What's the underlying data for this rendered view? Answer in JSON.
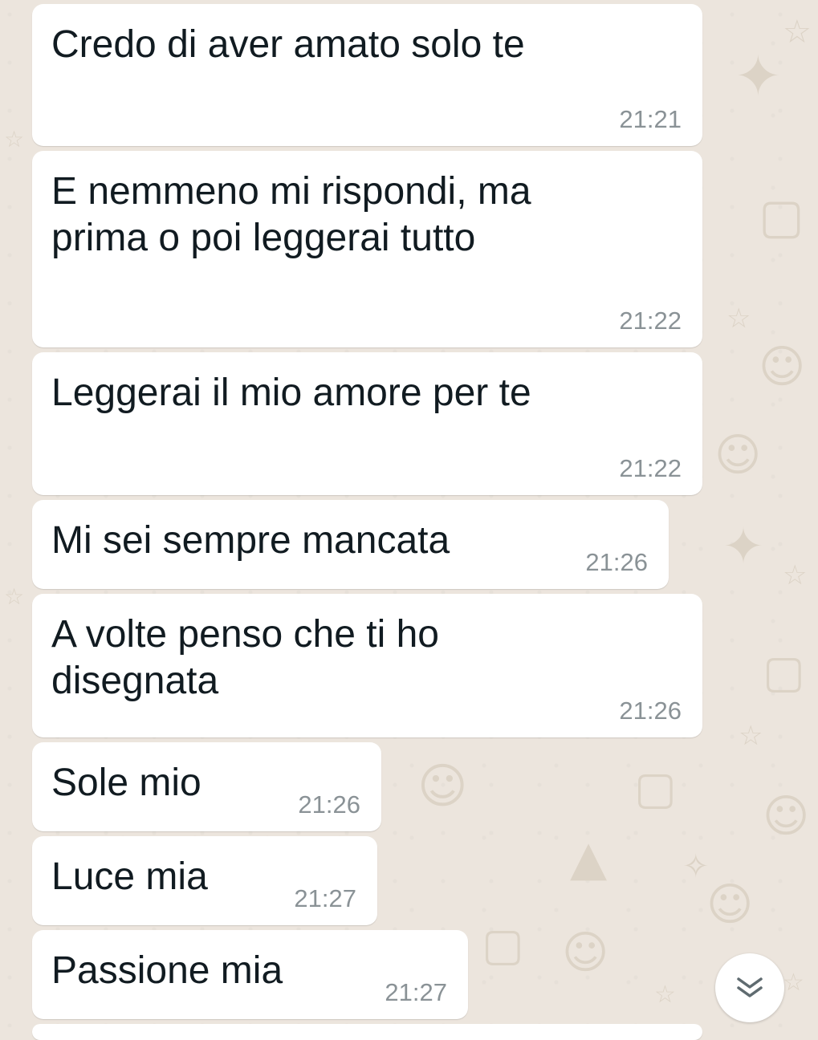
{
  "messages": [
    {
      "text": "Credo di aver amato solo te",
      "time": "21:21"
    },
    {
      "text": "E nemmeno mi rispondi, ma\nprima o poi leggerai tutto",
      "time": "21:22"
    },
    {
      "text": "Leggerai il mio amore per te",
      "time": "21:22"
    },
    {
      "text": "Mi sei sempre mancata",
      "time": "21:26"
    },
    {
      "text": "A volte penso che ti ho\ndisegnata",
      "time": "21:26"
    },
    {
      "text": "Sole mio",
      "time": "21:26"
    },
    {
      "text": "Luce mia",
      "time": "21:27"
    },
    {
      "text": "Passione mia",
      "time": "21:27"
    }
  ],
  "scroll_button": {
    "icon": "double-chevron-down-icon"
  },
  "colors": {
    "wallpaper": "#ece5dd",
    "bubble": "#ffffff",
    "text": "#111b21",
    "timestamp": "#8a9296"
  }
}
